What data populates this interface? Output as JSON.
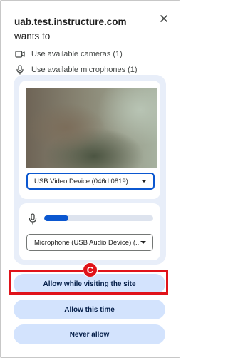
{
  "dialog": {
    "site": "uab.test.instructure.com",
    "title_rest": " wants to",
    "close_icon": "close-icon"
  },
  "permissions": [
    {
      "label": "Use available cameras (1)",
      "icon": "camera-icon"
    },
    {
      "label": "Use available microphones (1)",
      "icon": "microphone-icon"
    }
  ],
  "camera": {
    "selected": "USB Video Device (046d:0819)"
  },
  "microphone": {
    "selected": "Microphone (USB Audio Device) (...",
    "level": 0.22
  },
  "buttons": {
    "allow_site": "Allow while visiting the site",
    "allow_once": "Allow this time",
    "never": "Never allow"
  },
  "annotation": {
    "badge": "C",
    "color": "#e0131a"
  },
  "colors": {
    "accent": "#0b57d0",
    "button_bg": "#d3e3fd",
    "panel_bg": "#e8eef9"
  }
}
